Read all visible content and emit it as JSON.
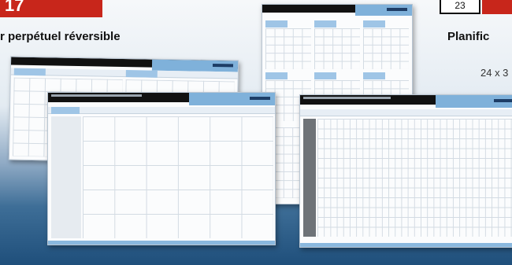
{
  "left_panel": {
    "badge_text": "17",
    "heading": "r perpétuel réversible"
  },
  "right_panel": {
    "box_text": "23",
    "heading": "Planific",
    "dimensions": "24 x 3"
  },
  "colors": {
    "accent_red": "#c8261b",
    "sheet_blue": "#7fb1da",
    "background_blue": "#1f4f7b"
  }
}
